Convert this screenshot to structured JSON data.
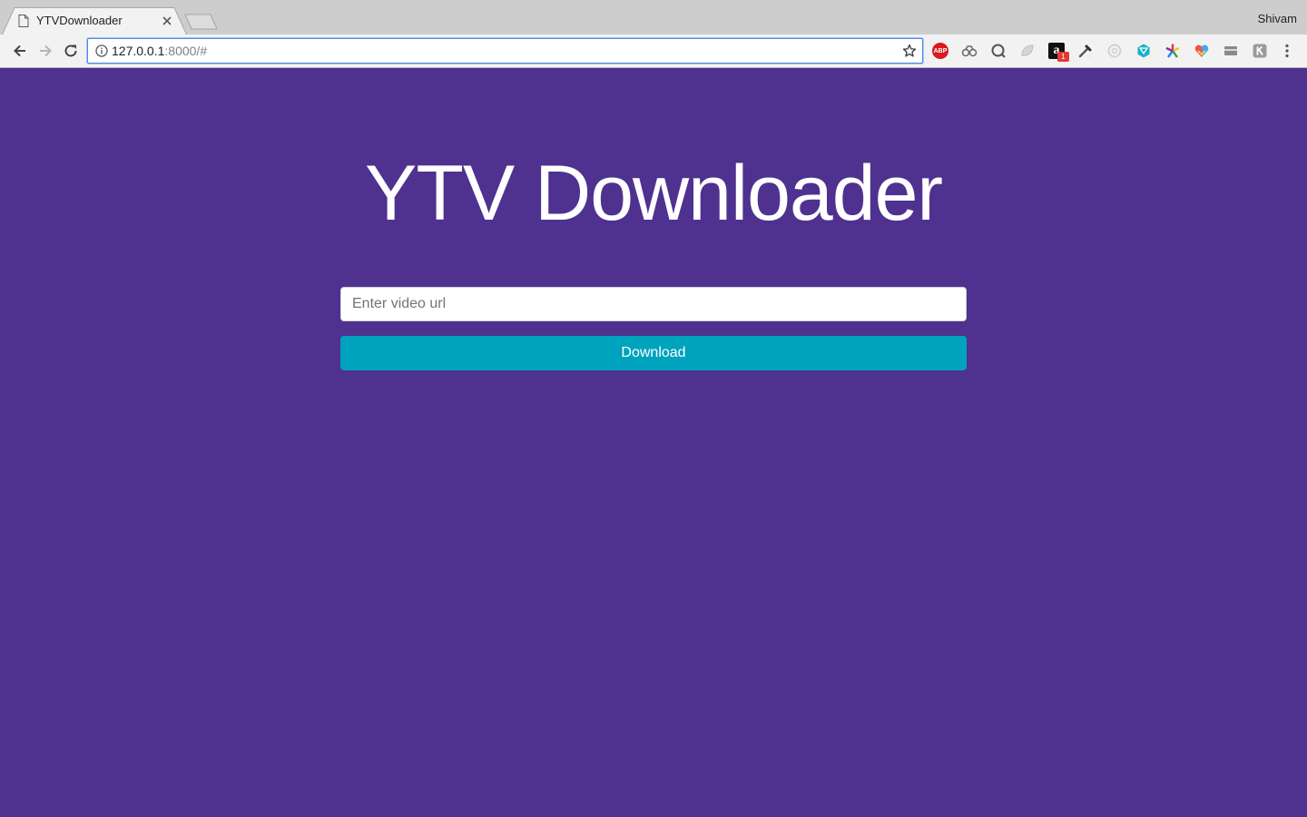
{
  "browser": {
    "tab": {
      "title": "YTVDownloader"
    },
    "profile_name": "Shivam",
    "address_bar": {
      "host": "127.0.0.1",
      "rest": ":8000/#"
    },
    "toolbar_icons": [
      "back-icon",
      "forward-icon",
      "reload-icon",
      "site-info-icon",
      "bookmark-star-icon",
      "chrome-menu-icon"
    ],
    "extensions": [
      {
        "name": "adblock-plus-extension-icon",
        "label": "ABP"
      },
      {
        "name": "binoculars-extension-icon"
      },
      {
        "name": "search-extension-icon"
      },
      {
        "name": "leaf-extension-icon"
      },
      {
        "name": "amazon-extension-icon",
        "label": "a",
        "badge": "1"
      },
      {
        "name": "eyedropper-extension-icon"
      },
      {
        "name": "circle-extension-icon"
      },
      {
        "name": "hexagon-extension-icon"
      },
      {
        "name": "pinwheel-extension-icon"
      },
      {
        "name": "heart-extension-icon"
      },
      {
        "name": "card-extension-icon"
      },
      {
        "name": "k-extension-icon",
        "label": "K"
      }
    ]
  },
  "page": {
    "heading": "YTV Downloader",
    "url_input": {
      "placeholder": "Enter video url",
      "value": ""
    },
    "download_button": {
      "label": "Download"
    }
  },
  "colors": {
    "page_background": "#4f3190",
    "button_background": "#00a3bd",
    "heading_text": "#ffffff"
  }
}
